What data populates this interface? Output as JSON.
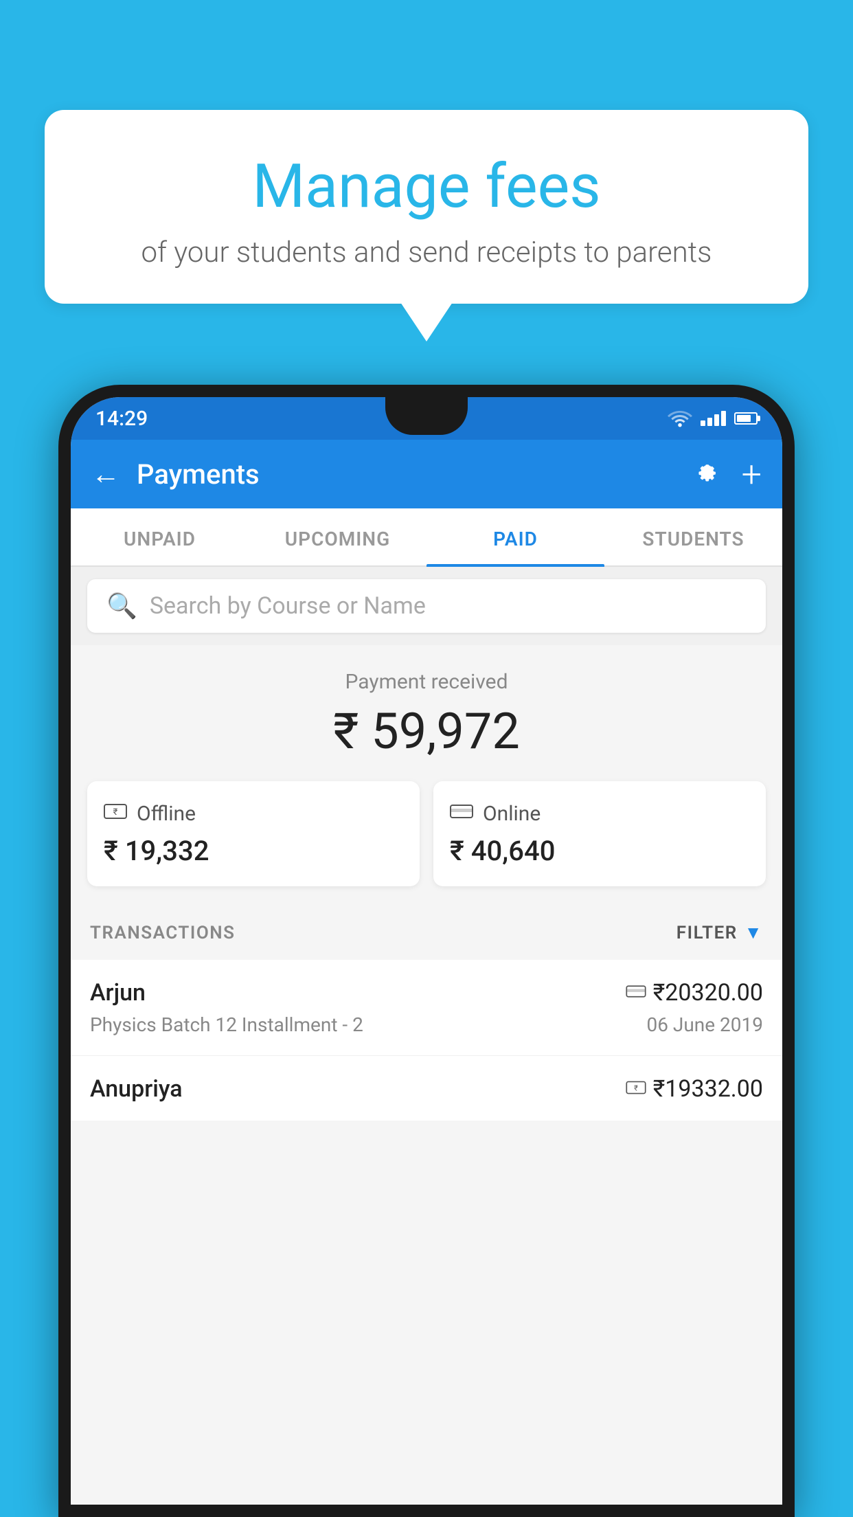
{
  "page": {
    "background_color": "#29B6E8"
  },
  "speech_bubble": {
    "title": "Manage fees",
    "subtitle": "of your students and send receipts to parents"
  },
  "status_bar": {
    "time": "14:29"
  },
  "app_header": {
    "title": "Payments",
    "back_label": "←",
    "gear_label": "⚙",
    "plus_label": "+"
  },
  "tabs": [
    {
      "label": "UNPAID",
      "active": false
    },
    {
      "label": "UPCOMING",
      "active": false
    },
    {
      "label": "PAID",
      "active": true
    },
    {
      "label": "STUDENTS",
      "active": false
    }
  ],
  "search": {
    "placeholder": "Search by Course or Name"
  },
  "payment_summary": {
    "label": "Payment received",
    "amount": "₹ 59,972",
    "offline": {
      "label": "Offline",
      "amount": "₹ 19,332"
    },
    "online": {
      "label": "Online",
      "amount": "₹ 40,640"
    }
  },
  "transactions_section": {
    "label": "TRANSACTIONS",
    "filter_label": "FILTER"
  },
  "transactions": [
    {
      "name": "Arjun",
      "course": "Physics Batch 12 Installment - 2",
      "amount": "₹20320.00",
      "date": "06 June 2019",
      "type": "online"
    },
    {
      "name": "Anupriya",
      "course": "",
      "amount": "₹19332.00",
      "date": "",
      "type": "offline"
    }
  ]
}
